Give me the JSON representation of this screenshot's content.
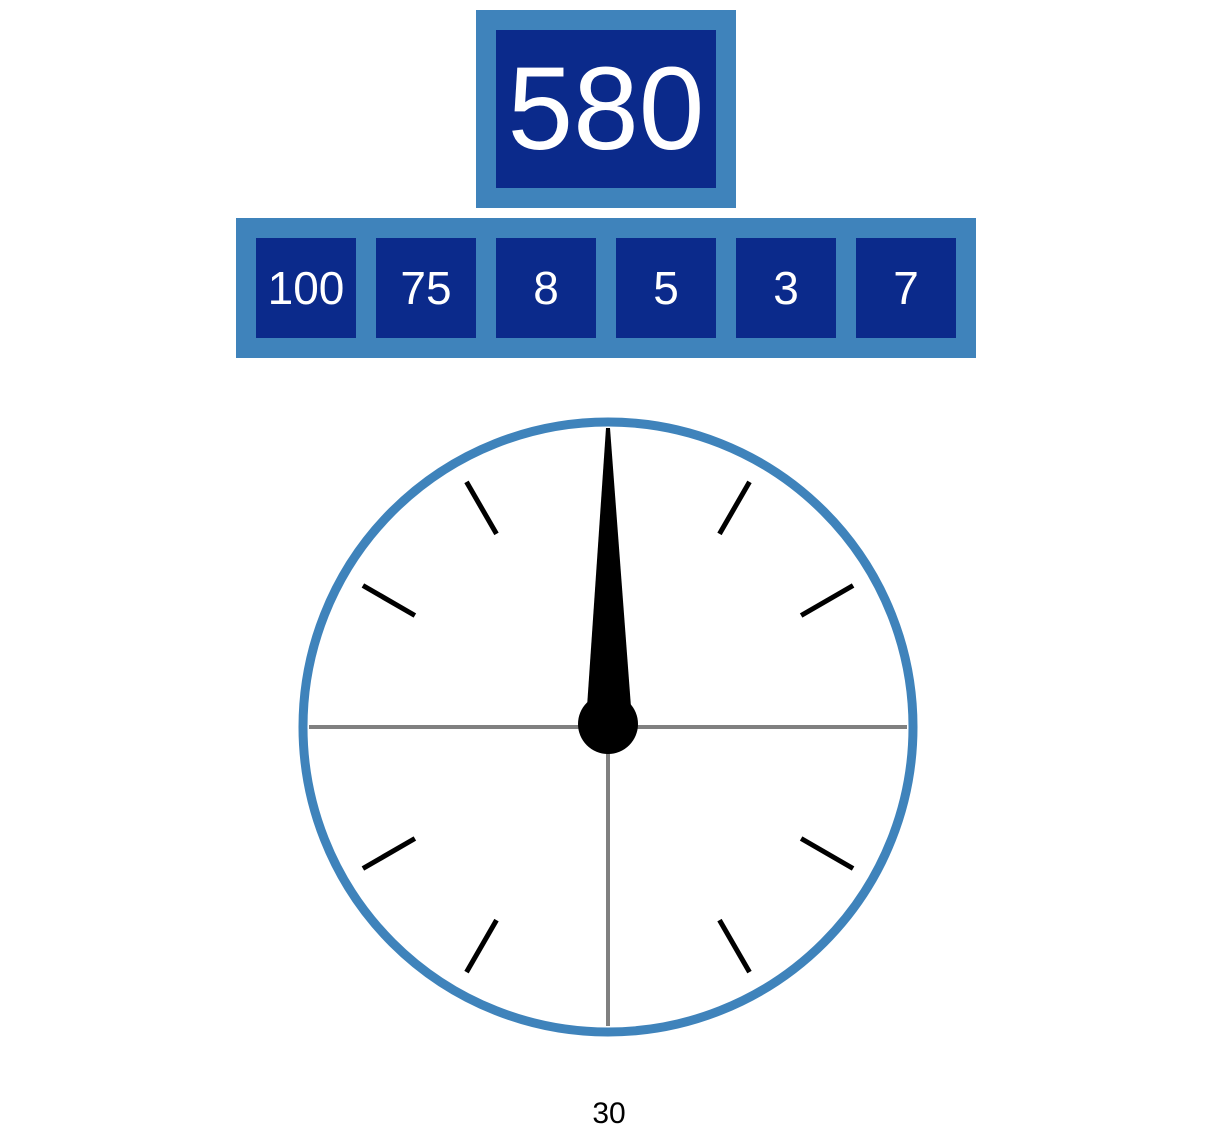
{
  "target": {
    "value": "580"
  },
  "numbers": [
    {
      "label": "100"
    },
    {
      "label": "75"
    },
    {
      "label": "8"
    },
    {
      "label": "5"
    },
    {
      "label": "3"
    },
    {
      "label": "7"
    }
  ],
  "timer": {
    "readout": "30",
    "elapsed_fraction": 0.0
  },
  "colors": {
    "frame": "#3f83bb",
    "tile": "#0b2a8b",
    "tile_text": "#ffffff",
    "clock_rim": "#3f83bb",
    "clock_axes": "#808080",
    "hand": "#000000"
  }
}
